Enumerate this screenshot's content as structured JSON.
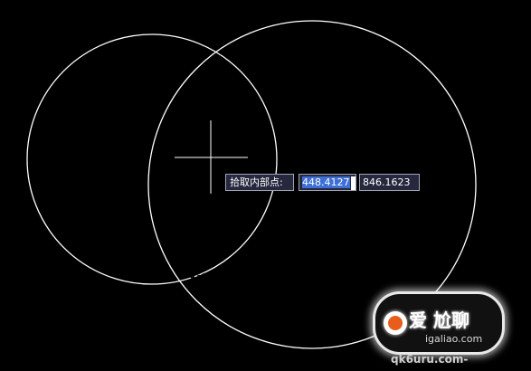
{
  "prompt": {
    "label": "拾取内部点:",
    "x_value": "448.4127",
    "y_value": "846.1623"
  },
  "watermark": {
    "text": "爱 尬聊",
    "url": "igaliao.com",
    "url_secondary": "qk6uru.com-"
  },
  "colors": {
    "background": "#000000",
    "geometry": "#ffffff",
    "selection": "#3d6fd6",
    "tooltip_bg": "#26283e"
  }
}
